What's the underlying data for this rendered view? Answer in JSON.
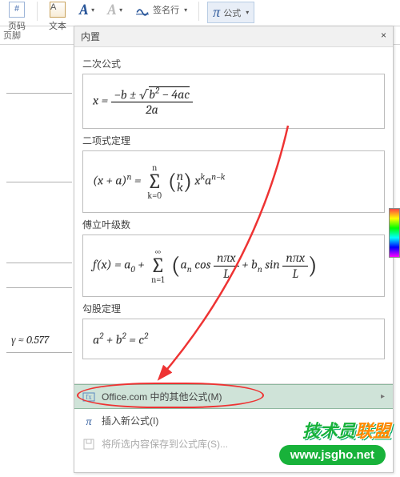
{
  "ribbon": {
    "pagenum_icon": "#",
    "pagenum_label": "页码",
    "textbox_label": "文本",
    "sigline_label": "签名行",
    "equation_label": "公式",
    "dropcap_label": "A",
    "wordart_label": "A"
  },
  "subbar": {
    "footer_label": "页脚"
  },
  "left": {
    "gamma": "γ ≈ 0.577"
  },
  "panel": {
    "header": "内置",
    "close": "×",
    "sections": [
      {
        "label": "二次公式"
      },
      {
        "label": "二项式定理"
      },
      {
        "label": "傅立叶级数"
      },
      {
        "label": "勾股定理"
      }
    ],
    "menu": {
      "more": "Office.com 中的其他公式(M)",
      "insert": "插入新公式(I)",
      "save": "将所选内容保存到公式库(S)..."
    }
  },
  "watermark": {
    "brand_a": "技术员",
    "brand_b": "联盟",
    "url": "www.jsgho.net"
  }
}
